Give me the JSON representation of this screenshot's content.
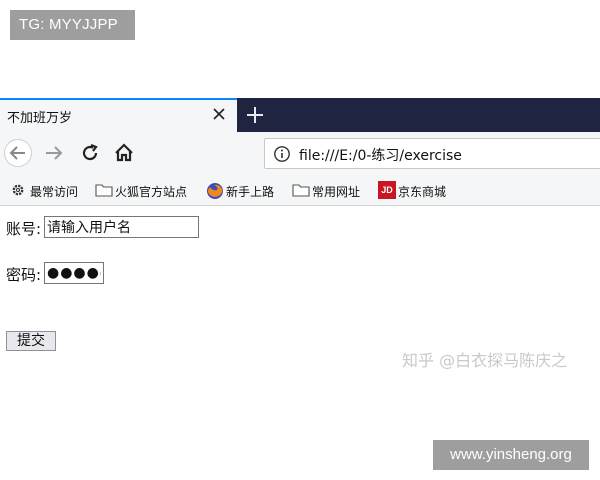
{
  "watermarks": {
    "top": "TG: MYYJJPP",
    "zhihu": "知乎 @白衣探马陈庆之",
    "bottom": "www.yinsheng.org"
  },
  "browser": {
    "tab_title": "不加班万岁",
    "url": "file:///E:/0-练习/exercise",
    "bookmarks": [
      {
        "label": "最常访问",
        "icon": "gear-icon"
      },
      {
        "label": "火狐官方站点",
        "icon": "folder-icon"
      },
      {
        "label": "新手上路",
        "icon": "firefox-icon"
      },
      {
        "label": "常用网址",
        "icon": "folder-icon"
      },
      {
        "label": "京东商城",
        "icon": "jd-icon",
        "icon_text": "JD"
      }
    ]
  },
  "form": {
    "account_label": "账号:",
    "account_value": "请输入用户名",
    "password_label": "密码:",
    "password_value": "●●●●●",
    "submit_label": "提交"
  }
}
